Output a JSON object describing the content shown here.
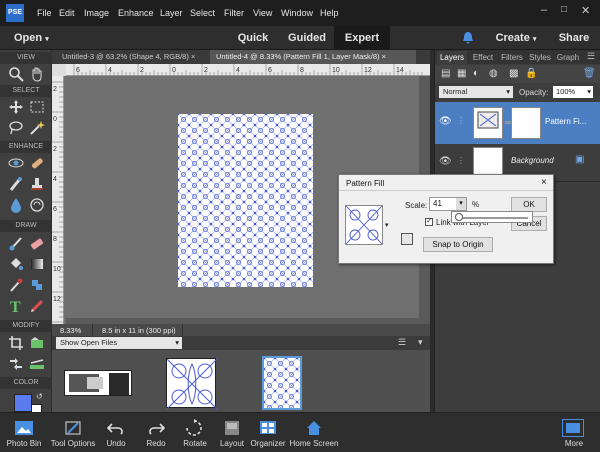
{
  "menu": {
    "items": [
      "File",
      "Edit",
      "Image",
      "Enhance",
      "Layer",
      "Select",
      "Filter",
      "View",
      "Window",
      "Help"
    ],
    "app_icon_text": "PSE"
  },
  "modebar": {
    "open_label": "Open",
    "quick": "Quick",
    "guided": "Guided",
    "expert": "Expert",
    "create": "Create",
    "share": "Share"
  },
  "doc_tabs": [
    {
      "label": "Untitled-3 @ 63.2% (Shape 4, RGB/8)",
      "close": "×"
    },
    {
      "label": "Untitled-4 @ 8.33% (Pattern Fill 1, Layer Mask/8)",
      "close": "×"
    }
  ],
  "toolbox_sections": [
    "VIEW",
    "SELECT",
    "ENHANCE",
    "DRAW",
    "MODIFY",
    "COLOR"
  ],
  "rulers": {
    "h_ticks": [
      "6",
      "4",
      "2",
      "0",
      "2",
      "4",
      "6",
      "8",
      "10",
      "12",
      "14"
    ],
    "v_ticks": [
      "2",
      "0",
      "2",
      "4",
      "6",
      "8",
      "10",
      "12",
      "1"
    ]
  },
  "status": {
    "zoom": "8.33%",
    "doc_info": "8.5 in x 11 in (300 ppi)"
  },
  "bin": {
    "show_label": "Show Open Files"
  },
  "panels": {
    "tabs": [
      "Layers",
      "Effect",
      "Filters",
      "Styles",
      "Graph"
    ],
    "blend_mode": "Normal",
    "opacity_label": "Opacity:",
    "opacity_value": "100%",
    "layers": [
      {
        "name": "Pattern Fi...",
        "selected": true
      },
      {
        "name": "Background",
        "selected": false
      }
    ]
  },
  "dialog": {
    "title": "Pattern Fill",
    "scale_label": "Scale:",
    "scale_value": "41",
    "unit": "%",
    "ok": "OK",
    "cancel": "Cancel",
    "link_label": "Link with Layer",
    "link_checked": true,
    "snap": "Snap to Origin",
    "close": "×"
  },
  "taskbar": [
    "Photo Bin",
    "Tool Options",
    "Undo",
    "Redo",
    "Rotate",
    "Layout",
    "Organizer",
    "Home Screen",
    "More"
  ],
  "colors": {
    "accent": "#2c6ec9",
    "pattern": "#4a5bd6",
    "selected_layer": "#4b7fc1",
    "foreground": "#5a7cf0"
  }
}
